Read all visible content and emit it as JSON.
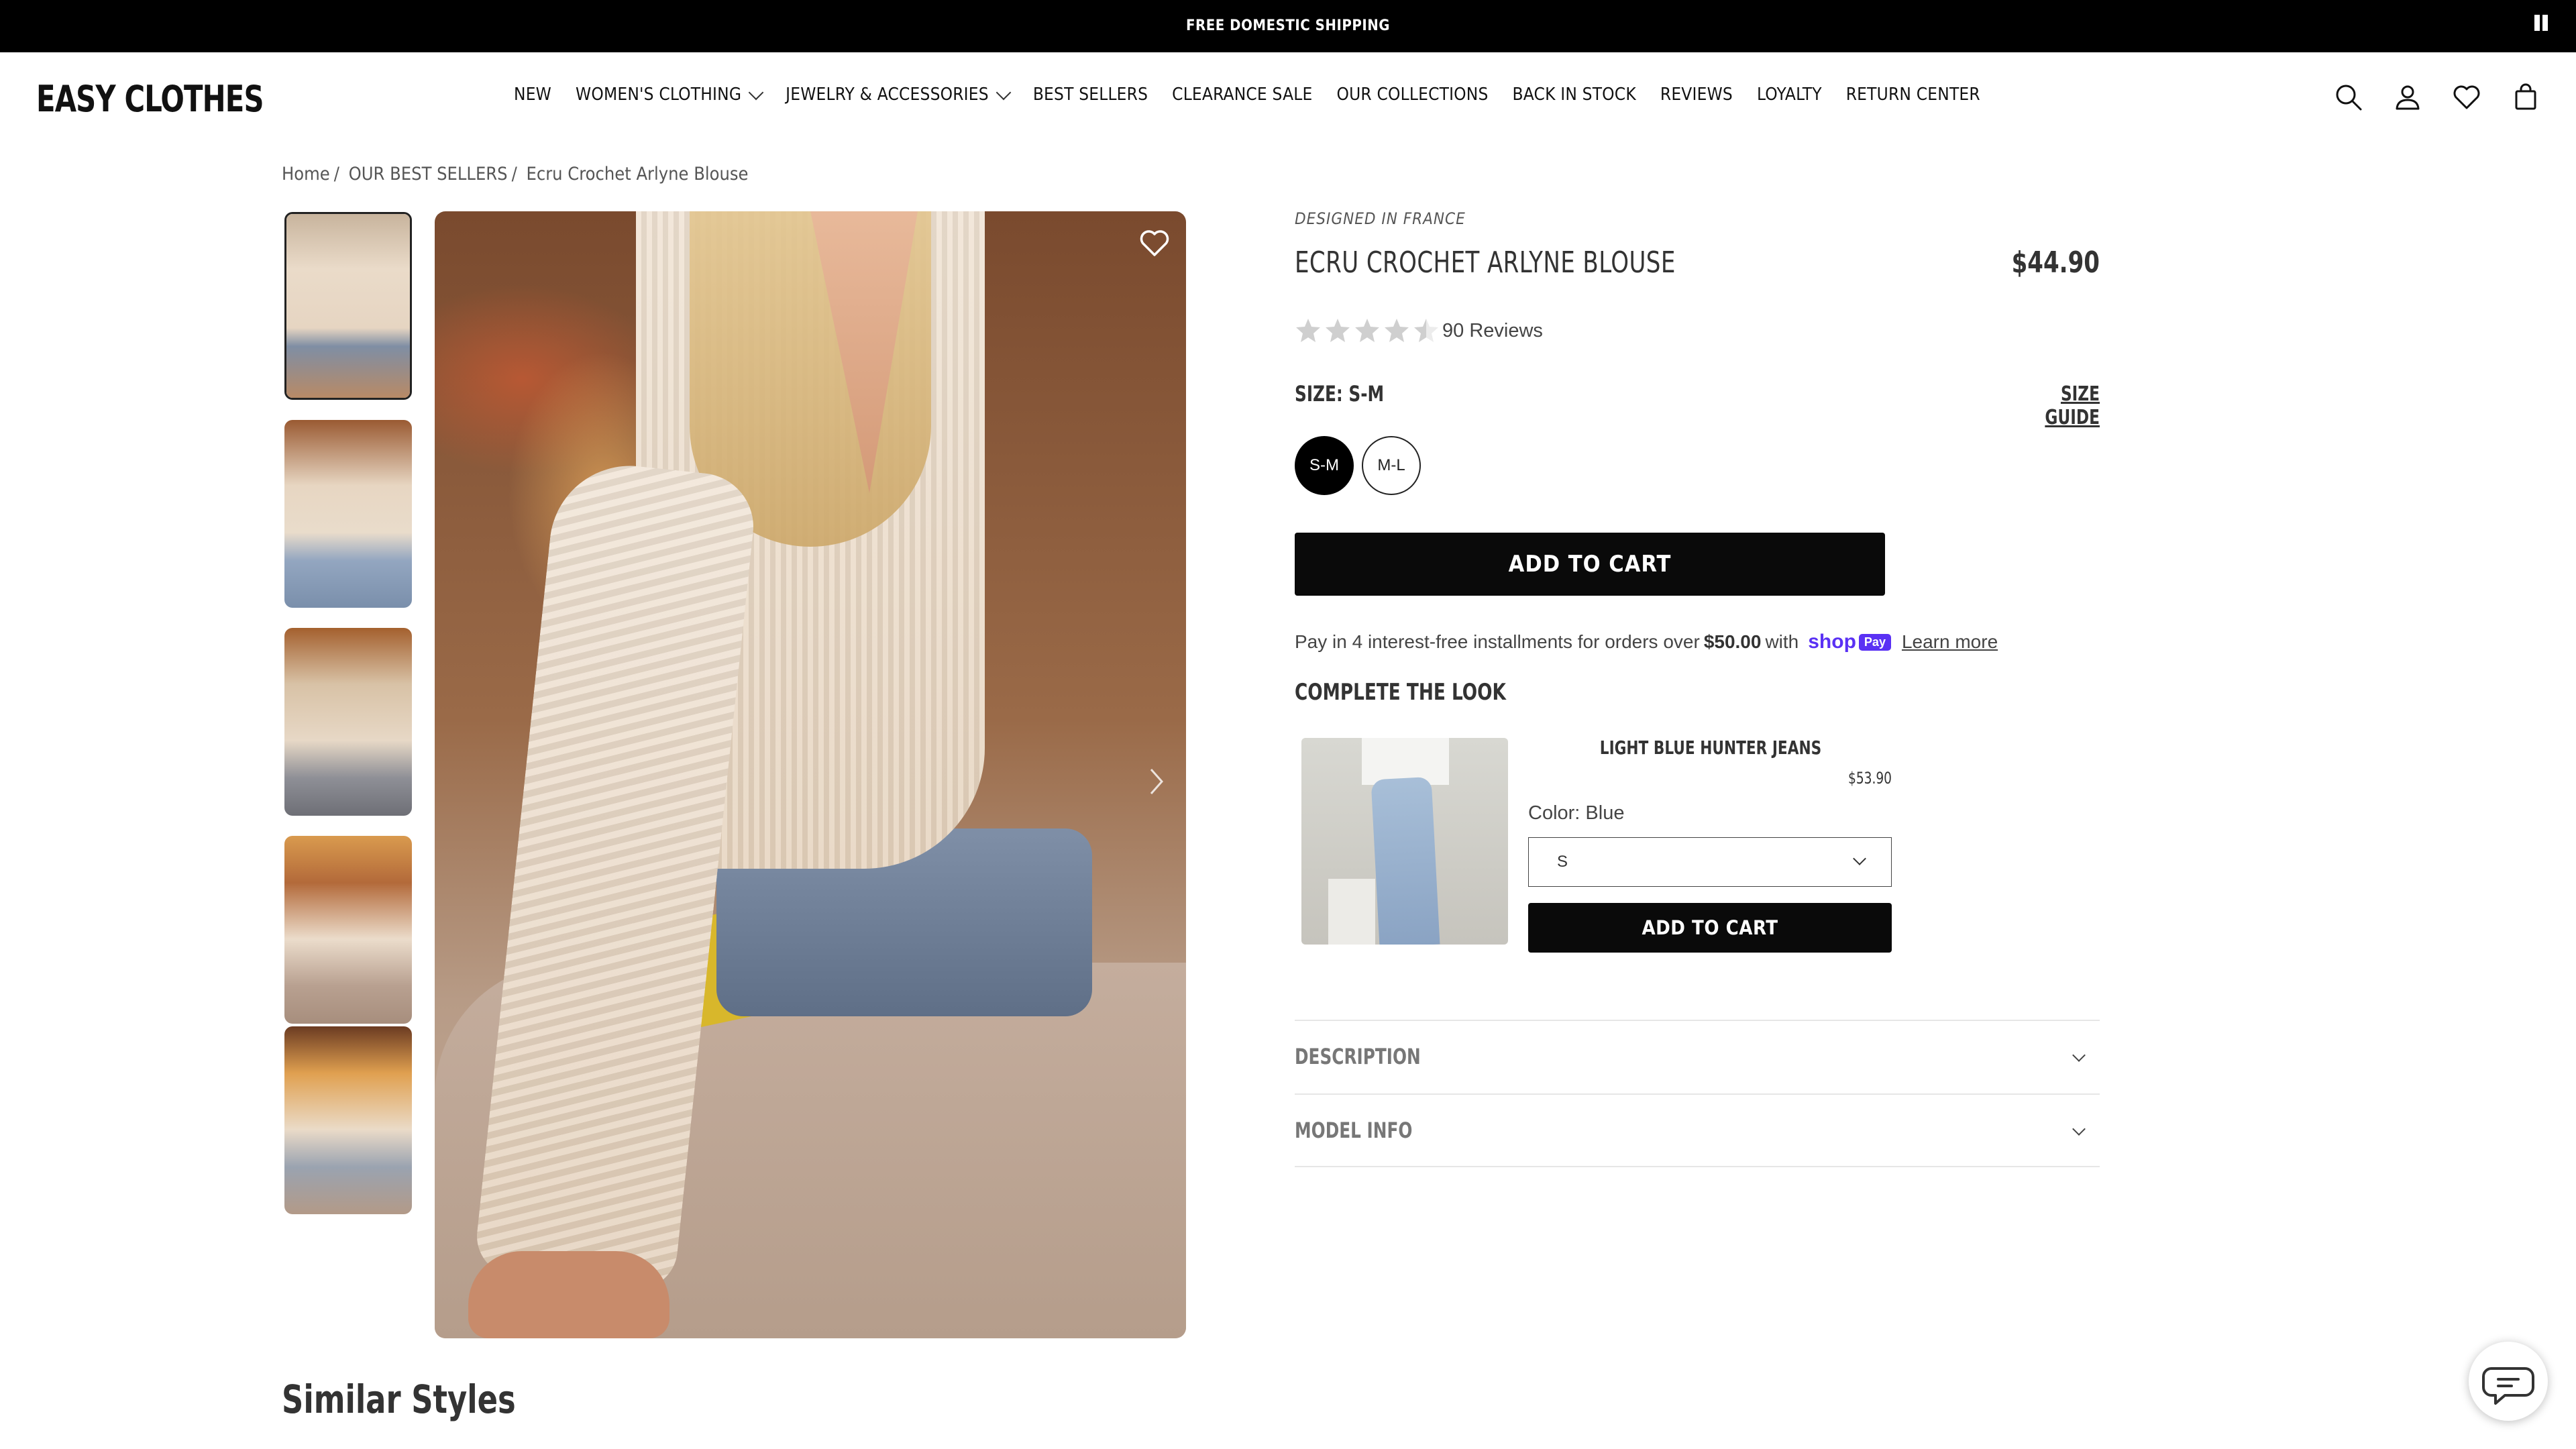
{
  "announcement": {
    "text": "FREE DOMESTIC SHIPPING"
  },
  "header": {
    "logo": "EASY CLOTHES",
    "nav": [
      {
        "label": "NEW",
        "has_dropdown": false
      },
      {
        "label": "WOMEN'S CLOTHING",
        "has_dropdown": true
      },
      {
        "label": "JEWELRY & ACCESSORIES",
        "has_dropdown": true
      },
      {
        "label": "BEST SELLERS",
        "has_dropdown": false
      },
      {
        "label": "CLEARANCE SALE",
        "has_dropdown": false
      },
      {
        "label": "OUR COLLECTIONS",
        "has_dropdown": false
      },
      {
        "label": "BACK IN STOCK",
        "has_dropdown": false
      },
      {
        "label": "REVIEWS",
        "has_dropdown": false
      },
      {
        "label": "LOYALTY",
        "has_dropdown": false
      },
      {
        "label": "RETURN CENTER",
        "has_dropdown": false
      }
    ],
    "icons": [
      "search-icon",
      "account-icon",
      "wishlist-icon",
      "cart-icon"
    ]
  },
  "breadcrumb": [
    "Home",
    "OUR BEST SELLERS",
    "Ecru Crochet Arlyne Blouse"
  ],
  "gallery": {
    "thumbnail_count": 5,
    "active_index": 0
  },
  "product": {
    "designed_in": "DESIGNED IN FRANCE",
    "title": "ECRU CROCHET ARLYNE BLOUSE",
    "price": "$44.90",
    "rating": 4.5,
    "reviews_label": "90 Reviews",
    "size_label": "SIZE: S-M",
    "size_guide_label": "SIZE GUIDE",
    "sizes": [
      {
        "label": "S-M",
        "selected": true
      },
      {
        "label": "M-L",
        "selected": false
      }
    ],
    "add_to_cart_label": "ADD TO CART",
    "installments": {
      "prefix": "Pay in 4 interest-free installments for orders over",
      "amount": "$50.00",
      "suffix": "with",
      "brand": "shop",
      "brand_badge": "Pay",
      "learn_more": "Learn more"
    }
  },
  "complete_the_look": {
    "heading": "COMPLETE THE LOOK",
    "item": {
      "name": "LIGHT BLUE HUNTER JEANS",
      "price": "$53.90",
      "color_label": "Color: Blue",
      "size_value": "S",
      "add_label": "ADD TO CART"
    }
  },
  "accordions": [
    {
      "label": "DESCRIPTION"
    },
    {
      "label": "MODEL INFO"
    }
  ],
  "similar_heading": "Similar Styles",
  "colors": {
    "accent": "#0a0a0a",
    "shoppay": "#5a31f4",
    "star": "#cfcfcf"
  }
}
